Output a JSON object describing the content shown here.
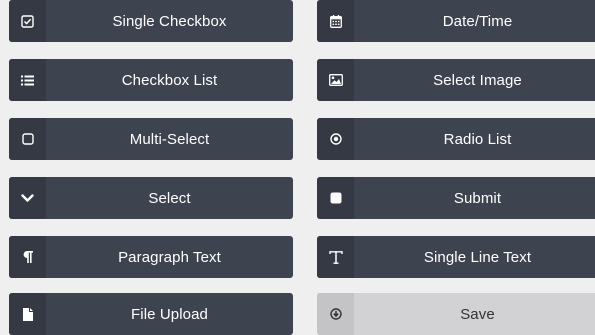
{
  "fields": {
    "left": [
      {
        "label": "Single Checkbox",
        "icon": "checkbox-checked-icon"
      },
      {
        "label": "Checkbox List",
        "icon": "list-icon"
      },
      {
        "label": "Multi-Select",
        "icon": "checkbox-empty-icon"
      },
      {
        "label": "Select",
        "icon": "chevron-down-icon"
      },
      {
        "label": "Paragraph Text",
        "icon": "paragraph-icon"
      },
      {
        "label": "File Upload",
        "icon": "file-icon"
      }
    ],
    "right": [
      {
        "label": "Date/Time",
        "icon": "calendar-icon"
      },
      {
        "label": "Select Image",
        "icon": "image-icon"
      },
      {
        "label": "Radio List",
        "icon": "radio-icon"
      },
      {
        "label": "Submit",
        "icon": "square-icon"
      },
      {
        "label": "Single Line Text",
        "icon": "text-icon"
      },
      {
        "label": "Save",
        "icon": "download-circle-icon",
        "state": "disabled"
      }
    ]
  },
  "colors": {
    "button_bg": "#3e4350",
    "icon_cell_bg": "#353944",
    "disabled_bg": "#d2d2d4",
    "page_bg": "#efefef"
  }
}
